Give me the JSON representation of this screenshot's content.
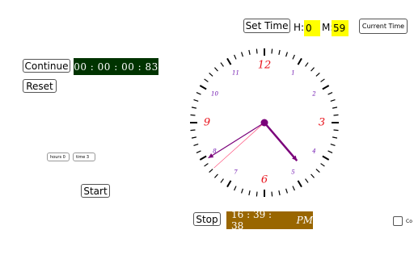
{
  "controls": {
    "continue_label": "Continue",
    "reset_label": "Reset",
    "start_label": "Start",
    "stop_label": "Stop",
    "set_time_label": "Set Time",
    "current_time_label": "Current Time",
    "hour_label": "H:",
    "hour_value": "0",
    "minute_label": "M:",
    "minute_value": "59",
    "hours_field": "hours 0",
    "time_field": "time 3",
    "checkbox_label": "Co"
  },
  "timer": {
    "display": "00 : 00 : 00 : 83"
  },
  "digital_clock": {
    "time": "16 : 39 : 38",
    "ampm": "PM"
  },
  "clock": {
    "hour": 4,
    "minute": 39,
    "second": 38,
    "numerals": [
      {
        "n": "12",
        "size": "big"
      },
      {
        "n": "1",
        "size": "small"
      },
      {
        "n": "2",
        "size": "small"
      },
      {
        "n": "3",
        "size": "big"
      },
      {
        "n": "4",
        "size": "small"
      },
      {
        "n": "5",
        "size": "small"
      },
      {
        "n": "6",
        "size": "big"
      },
      {
        "n": "7",
        "size": "small"
      },
      {
        "n": "8",
        "size": "small"
      },
      {
        "n": "9",
        "size": "big"
      },
      {
        "n": "10",
        "size": "small"
      },
      {
        "n": "11",
        "size": "small"
      }
    ],
    "colors": {
      "big_numeral": "#e8121b",
      "small_numeral": "#6a0dad",
      "hand": "#7a007a",
      "second_hand": "#ff3366",
      "tick": "#000000"
    }
  }
}
